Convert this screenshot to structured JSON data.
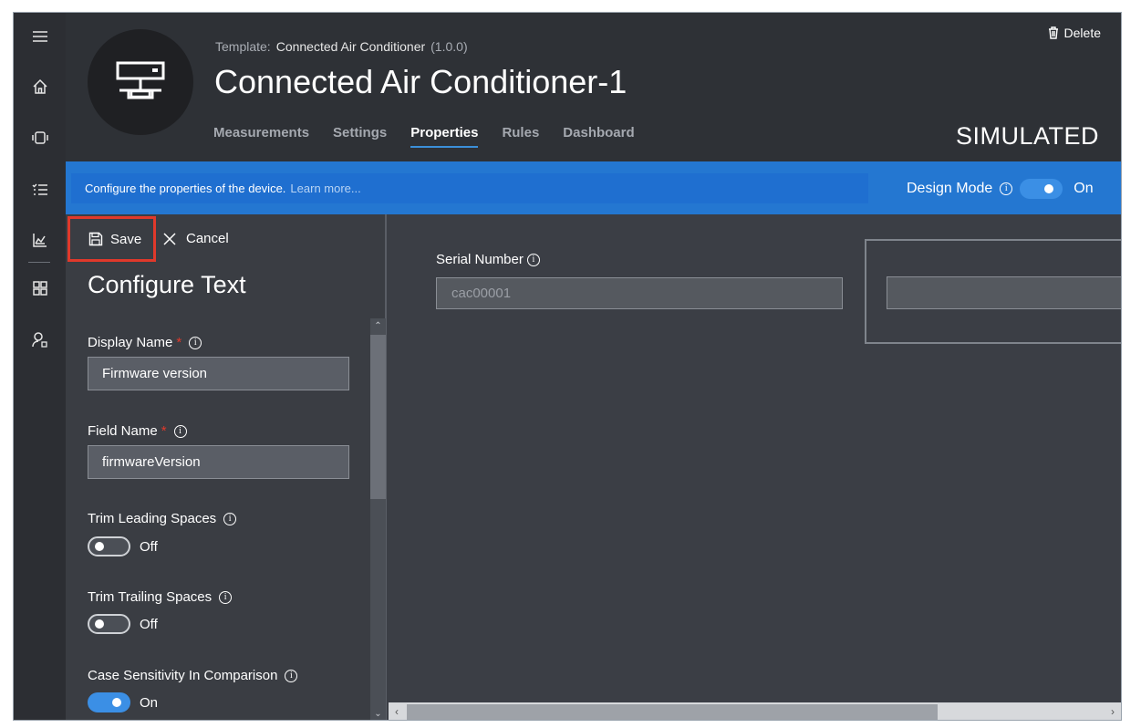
{
  "rail": {
    "items": [
      "hamburger-icon",
      "home-icon",
      "devices-icon",
      "rules-list-icon",
      "analytics-icon",
      "dashboard-grid-icon",
      "user-admin-icon"
    ]
  },
  "header": {
    "template_label": "Template:",
    "template_name": "Connected Air Conditioner",
    "template_version": "(1.0.0)",
    "device_title": "Connected Air Conditioner-1",
    "delete_label": "Delete",
    "status": "SIMULATED",
    "tabs": [
      "Measurements",
      "Settings",
      "Properties",
      "Rules",
      "Dashboard"
    ],
    "active_tab": "Properties"
  },
  "infobar": {
    "message": "Configure the properties of the device.",
    "learn_more": "Learn more...",
    "design_mode_label": "Design Mode",
    "design_mode_state": "On",
    "design_mode_on": true
  },
  "panel": {
    "save_label": "Save",
    "cancel_label": "Cancel",
    "title": "Configure Text",
    "display_name_label": "Display Name",
    "display_name_value": "Firmware version",
    "field_name_label": "Field Name",
    "field_name_value": "firmwareVersion",
    "required_mark": "*",
    "trim_leading_label": "Trim Leading Spaces",
    "trim_leading_state": "Off",
    "trim_trailing_label": "Trim Trailing Spaces",
    "trim_trailing_state": "Off",
    "case_sensitivity_label": "Case Sensitivity In Comparison",
    "case_sensitivity_state": "On"
  },
  "canvas": {
    "serial_label": "Serial Number",
    "serial_value": "cac00001"
  },
  "colors": {
    "accent": "#2477d1",
    "highlight_border": "#e0392b",
    "toggle_on": "#3b8fe5"
  }
}
